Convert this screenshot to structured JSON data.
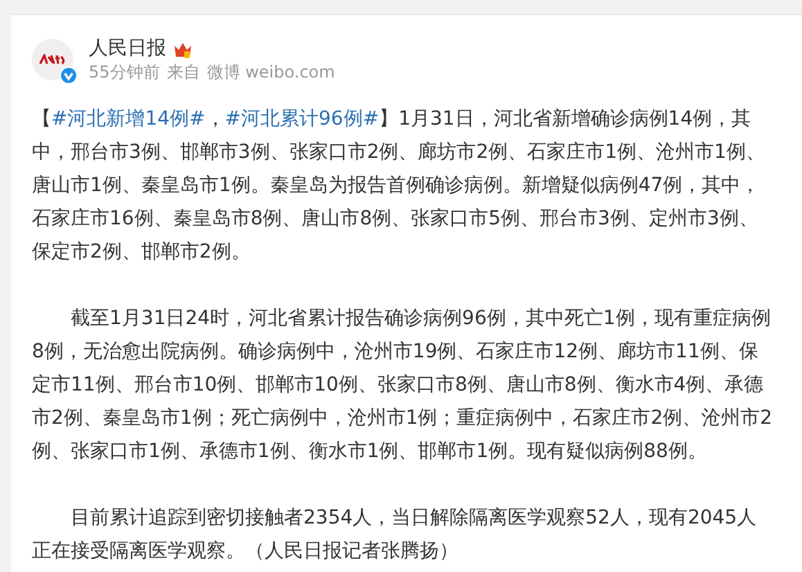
{
  "author": {
    "name": "人民日报",
    "time": "55分钟前",
    "from_label": "来自",
    "source": "微博 weibo.com"
  },
  "paragraphs": [
    {
      "indented": false,
      "segments": [
        {
          "kind": "text",
          "text": "【"
        },
        {
          "kind": "hashtag",
          "text": "#河北新增14例#"
        },
        {
          "kind": "text",
          "text": "，"
        },
        {
          "kind": "hashtag",
          "text": "#河北累计96例#"
        },
        {
          "kind": "text",
          "text": "】1月31日，河北省新增确诊病例14例，其中，邢台市3例、邯郸市3例、张家口市2例、廊坊市2例、石家庄市1例、沧州市1例、唐山市1例、秦皇岛市1例。秦皇岛为报告首例确诊病例。新增疑似病例47例，其中，石家庄市16例、秦皇岛市8例、唐山市8例、张家口市5例、邢台市3例、定州市3例、保定市2例、邯郸市2例。"
        }
      ]
    },
    {
      "indented": true,
      "segments": [
        {
          "kind": "text",
          "text": "截至1月31日24时，河北省累计报告确诊病例96例，其中死亡1例，现有重症病例8例，无治愈出院病例。确诊病例中，沧州市19例、石家庄市12例、廊坊市11例、保定市11例、邢台市10例、邯郸市10例、张家口市8例、唐山市8例、衡水市4例、承德市2例、秦皇岛市1例；死亡病例中，沧州市1例；重症病例中，石家庄市2例、沧州市2例、张家口市1例、承德市1例、衡水市1例、邯郸市1例。现有疑似病例88例。"
        }
      ]
    },
    {
      "indented": true,
      "segments": [
        {
          "kind": "text",
          "text": "目前累计追踪到密切接触者2354人，当日解除隔离医学观察52人，现有2045人正在接受隔离医学观察。（人民日报记者张腾扬）"
        }
      ]
    }
  ]
}
